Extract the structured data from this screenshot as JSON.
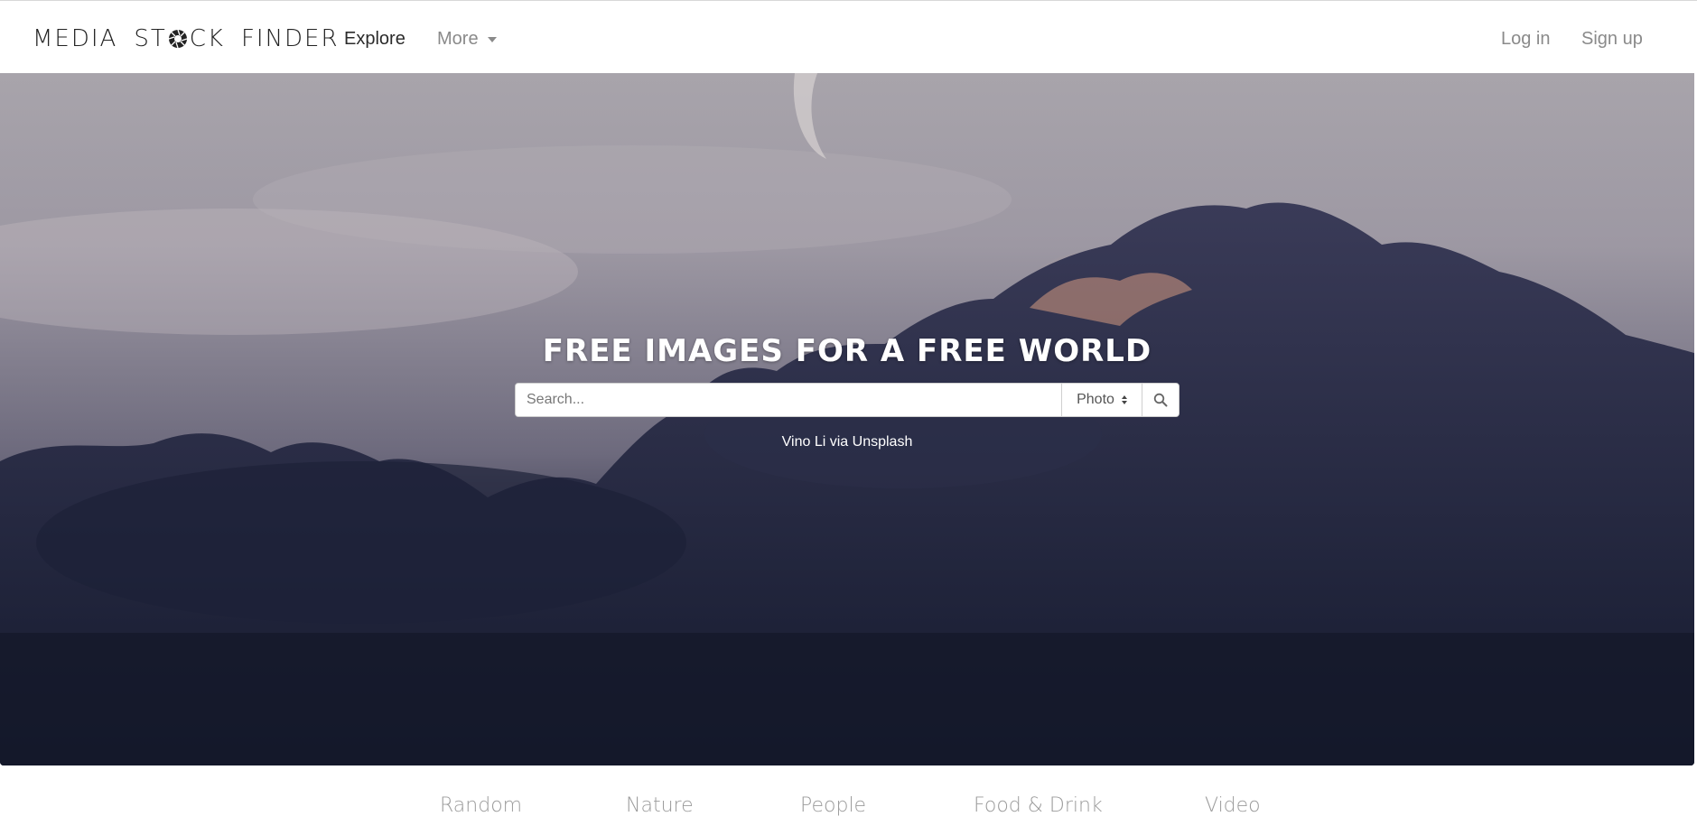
{
  "brand": {
    "part1": "MEDIA",
    "part2_a": "ST",
    "part2_b": "CK",
    "part3": "FINDER"
  },
  "nav": {
    "explore": "Explore",
    "more": "More",
    "login": "Log in",
    "signup": "Sign up"
  },
  "hero": {
    "title": "FREE IMAGES FOR A FREE WORLD",
    "search_placeholder": "Search...",
    "search_type": "Photo",
    "credit": "Vino Li via Unsplash"
  },
  "categories": [
    "Random",
    "Nature",
    "People",
    "Food & Drink",
    "Video"
  ],
  "colors": {
    "nav_text": "#8a8a8a",
    "category_text": "#9b9b9b"
  }
}
